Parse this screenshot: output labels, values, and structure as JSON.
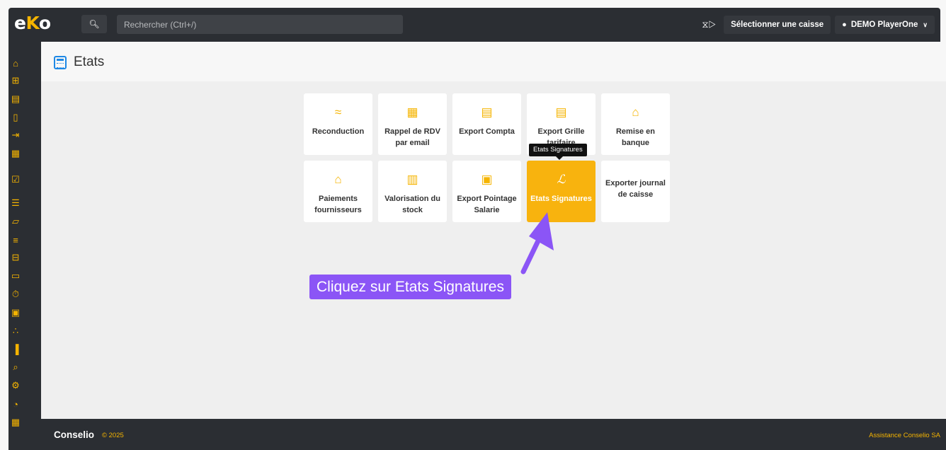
{
  "header": {
    "logo": "eko",
    "search_placeholder": "Rechercher (Ctrl+/)",
    "select_register_label": "Sélectionner une caisse",
    "user_label": "DEMO PlayerOne"
  },
  "sidebar": {
    "icons": [
      "home-icon",
      "plus-square-icon",
      "list-icon",
      "document-icon",
      "exit-doc-icon",
      "calendar-icon",
      "calendar-check-icon",
      "checklist-icon",
      "folder-icon",
      "tags-icon",
      "hierarchy-icon",
      "cash-register-icon",
      "stopwatch-icon",
      "badge-icon",
      "network-icon",
      "bar-chart-icon",
      "search-icon",
      "gears-icon",
      "pie-chart-icon",
      "calculator-icon"
    ]
  },
  "page": {
    "title": "Etats"
  },
  "tiles": [
    {
      "label": "Reconduction",
      "icon": "handshake-icon"
    },
    {
      "label": "Rappel de RDV par email",
      "icon": "calendar-icon"
    },
    {
      "label": "Export Compta",
      "icon": "calculator-icon"
    },
    {
      "label": "Export Grille tarifaire",
      "icon": "list-icon"
    },
    {
      "label": "Remise en banque",
      "icon": "bank-icon"
    },
    {
      "label": "Paiements fournisseurs",
      "icon": "bank-icon"
    },
    {
      "label": "Valorisation du stock",
      "icon": "building-icon"
    },
    {
      "label": "Export Pointage Salarie",
      "icon": "id-badge-icon"
    },
    {
      "label": "Etats Signatures",
      "icon": "signature-icon"
    },
    {
      "label": "Exporter journal de caisse",
      "icon": ""
    }
  ],
  "tooltip": "Etats Signatures",
  "callout": "Cliquez sur Etats Signatures",
  "footer": {
    "brand": "Conselio",
    "copyright": "© 2025",
    "assistance": "Assistance Conselio SA"
  },
  "colors": {
    "accent": "#f5b400",
    "dark": "#2b2e33",
    "callout": "#8b55f6",
    "title_icon": "#1e88e5"
  }
}
